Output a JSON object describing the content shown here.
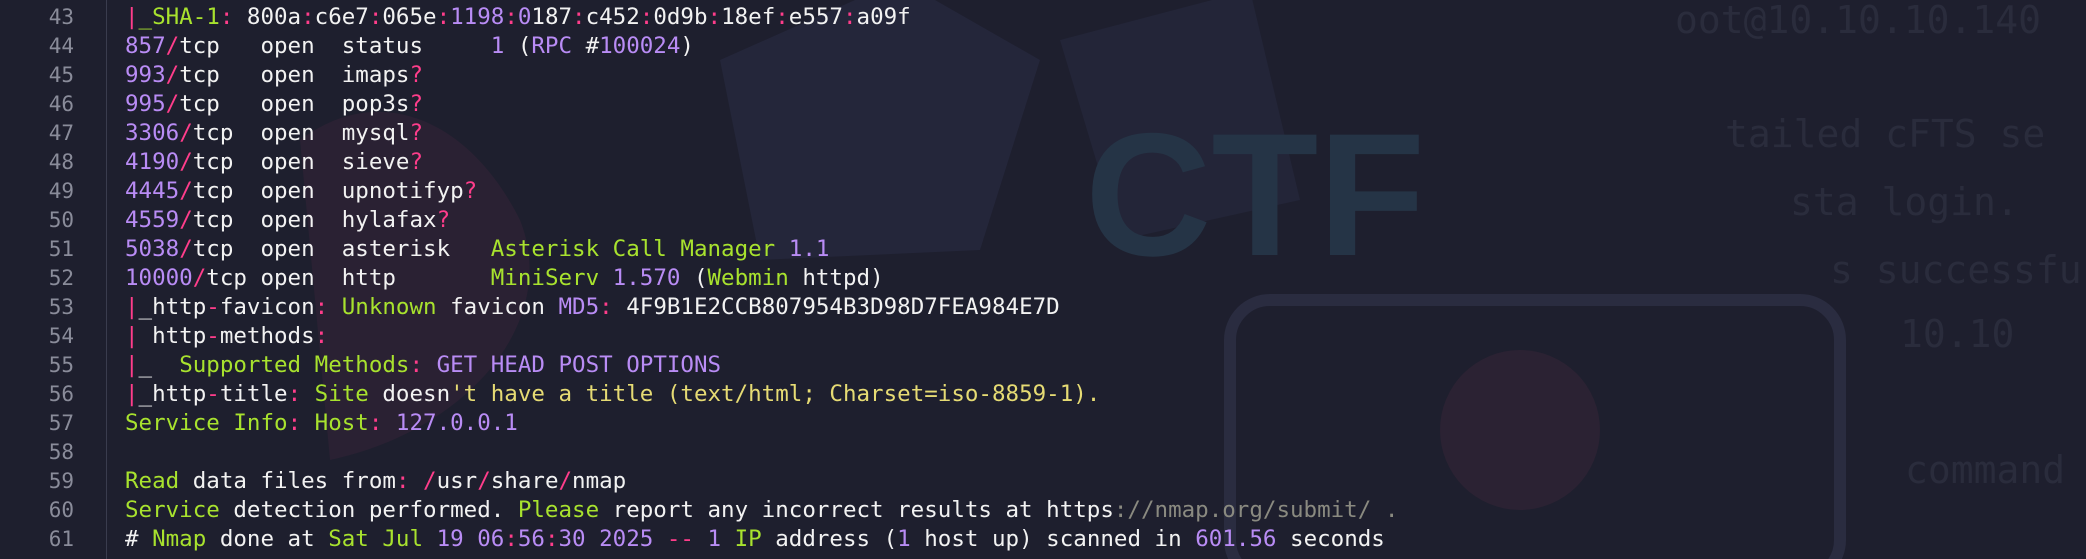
{
  "colors": {
    "background": "#1e1f2e",
    "default": "#f2f2f2",
    "number": "#b98cf5",
    "operator": "#ff3d8b",
    "keyword": "#a8e22e",
    "string": "#e6db74",
    "comment": "#8a8a80",
    "line_number": "#8a8c9a"
  },
  "background_watermark": {
    "logo_text": "CTF",
    "fragments": [
      "oot@10.10.10.140",
      "tailed cFTS se",
      "sta login.",
      "s successfu",
      "10.10",
      "command"
    ]
  },
  "editor": {
    "lines": [
      {
        "n": "43",
        "tokens": [
          [
            "|",
            "operator"
          ],
          [
            "_SHA-1",
            "keyword"
          ],
          [
            ":",
            "operator"
          ],
          [
            " 800a",
            "default"
          ],
          [
            ":",
            "operator"
          ],
          [
            "c6e7",
            "default"
          ],
          [
            ":",
            "operator"
          ],
          [
            "065e",
            "default"
          ],
          [
            ":",
            "operator"
          ],
          [
            "1198",
            "number"
          ],
          [
            ":",
            "operator"
          ],
          [
            "0",
            "number"
          ],
          [
            "187",
            "default"
          ],
          [
            ":",
            "operator"
          ],
          [
            "c452",
            "default"
          ],
          [
            ":",
            "operator"
          ],
          [
            "0d9b",
            "default"
          ],
          [
            ":",
            "operator"
          ],
          [
            "18ef",
            "default"
          ],
          [
            ":",
            "operator"
          ],
          [
            "e557",
            "default"
          ],
          [
            ":",
            "operator"
          ],
          [
            "a09f",
            "default"
          ]
        ]
      },
      {
        "n": "44",
        "tokens": [
          [
            "857",
            "number"
          ],
          [
            "/",
            "operator"
          ],
          [
            "tcp   open  status     ",
            "default"
          ],
          [
            "1",
            "number"
          ],
          [
            " (",
            "default"
          ],
          [
            "RPC",
            "number"
          ],
          [
            " #",
            "default"
          ],
          [
            "100024",
            "number"
          ],
          [
            ")",
            "default"
          ]
        ]
      },
      {
        "n": "45",
        "tokens": [
          [
            "993",
            "number"
          ],
          [
            "/",
            "operator"
          ],
          [
            "tcp   open  imaps",
            "default"
          ],
          [
            "?",
            "operator"
          ]
        ]
      },
      {
        "n": "46",
        "tokens": [
          [
            "995",
            "number"
          ],
          [
            "/",
            "operator"
          ],
          [
            "tcp   open  pop3s",
            "default"
          ],
          [
            "?",
            "operator"
          ]
        ]
      },
      {
        "n": "47",
        "tokens": [
          [
            "3306",
            "number"
          ],
          [
            "/",
            "operator"
          ],
          [
            "tcp  open  mysql",
            "default"
          ],
          [
            "?",
            "operator"
          ]
        ]
      },
      {
        "n": "48",
        "tokens": [
          [
            "4190",
            "number"
          ],
          [
            "/",
            "operator"
          ],
          [
            "tcp  open  sieve",
            "default"
          ],
          [
            "?",
            "operator"
          ]
        ]
      },
      {
        "n": "49",
        "tokens": [
          [
            "4445",
            "number"
          ],
          [
            "/",
            "operator"
          ],
          [
            "tcp  open  upnotifyp",
            "default"
          ],
          [
            "?",
            "operator"
          ]
        ]
      },
      {
        "n": "50",
        "tokens": [
          [
            "4559",
            "number"
          ],
          [
            "/",
            "operator"
          ],
          [
            "tcp  open  hylafax",
            "default"
          ],
          [
            "?",
            "operator"
          ]
        ]
      },
      {
        "n": "51",
        "tokens": [
          [
            "5038",
            "number"
          ],
          [
            "/",
            "operator"
          ],
          [
            "tcp  open  asterisk   ",
            "default"
          ],
          [
            "Asterisk Call Manager",
            "keyword"
          ],
          [
            " 1.1",
            "number"
          ]
        ]
      },
      {
        "n": "52",
        "tokens": [
          [
            "10000",
            "number"
          ],
          [
            "/",
            "operator"
          ],
          [
            "tcp open  http       ",
            "default"
          ],
          [
            "MiniServ",
            "keyword"
          ],
          [
            " 1.570",
            "number"
          ],
          [
            " (",
            "default"
          ],
          [
            "Webmin",
            "keyword"
          ],
          [
            " httpd)",
            "default"
          ]
        ]
      },
      {
        "n": "53",
        "tokens": [
          [
            "|",
            "operator"
          ],
          [
            "_http",
            "default"
          ],
          [
            "-",
            "operator"
          ],
          [
            "favicon",
            "default"
          ],
          [
            ":",
            "operator"
          ],
          [
            " Unknown",
            "keyword"
          ],
          [
            " favicon ",
            "default"
          ],
          [
            "MD5",
            "number"
          ],
          [
            ":",
            "operator"
          ],
          [
            " 4F9B1E2CCB807954B3D98D7FEA984E7D",
            "default"
          ]
        ]
      },
      {
        "n": "54",
        "tokens": [
          [
            "|",
            "operator"
          ],
          [
            " http",
            "default"
          ],
          [
            "-",
            "operator"
          ],
          [
            "methods",
            "default"
          ],
          [
            ":",
            "operator"
          ]
        ]
      },
      {
        "n": "55",
        "tokens": [
          [
            "|",
            "operator"
          ],
          [
            "_  ",
            "default"
          ],
          [
            "Supported Methods",
            "keyword"
          ],
          [
            ":",
            "operator"
          ],
          [
            " GET HEAD POST OPTIONS",
            "number"
          ]
        ]
      },
      {
        "n": "56",
        "tokens": [
          [
            "|",
            "operator"
          ],
          [
            "_http",
            "default"
          ],
          [
            "-",
            "operator"
          ],
          [
            "title",
            "default"
          ],
          [
            ":",
            "operator"
          ],
          [
            " Site",
            "keyword"
          ],
          [
            " doesn",
            "default"
          ],
          [
            "'t have a title (text/html; Charset=iso-8859-1).",
            "string"
          ]
        ]
      },
      {
        "n": "57",
        "tokens": [
          [
            "Service Info",
            "keyword"
          ],
          [
            ":",
            "operator"
          ],
          [
            " Host",
            "keyword"
          ],
          [
            ":",
            "operator"
          ],
          [
            " 127.0.0.1",
            "number"
          ]
        ]
      },
      {
        "n": "58",
        "tokens": []
      },
      {
        "n": "59",
        "tokens": [
          [
            "Read",
            "keyword"
          ],
          [
            " data files from",
            "default"
          ],
          [
            ":",
            "operator"
          ],
          [
            " ",
            "default"
          ],
          [
            "/",
            "operator"
          ],
          [
            "usr",
            "default"
          ],
          [
            "/",
            "operator"
          ],
          [
            "share",
            "default"
          ],
          [
            "/",
            "operator"
          ],
          [
            "nmap",
            "default"
          ]
        ]
      },
      {
        "n": "60",
        "tokens": [
          [
            "Service",
            "keyword"
          ],
          [
            " detection performed. ",
            "default"
          ],
          [
            "Please",
            "keyword"
          ],
          [
            " report any incorrect results at https",
            "default"
          ],
          [
            "://nmap.org/submit/ .",
            "comment"
          ]
        ]
      },
      {
        "n": "61",
        "tokens": [
          [
            "# ",
            "default"
          ],
          [
            "Nmap",
            "keyword"
          ],
          [
            " done at ",
            "default"
          ],
          [
            "Sat Jul",
            "keyword"
          ],
          [
            " 19 06",
            "number"
          ],
          [
            ":",
            "operator"
          ],
          [
            "56",
            "number"
          ],
          [
            ":",
            "operator"
          ],
          [
            "30 2025",
            "number"
          ],
          [
            " -- ",
            "operator"
          ],
          [
            "1",
            "number"
          ],
          [
            " IP",
            "keyword"
          ],
          [
            " address (",
            "default"
          ],
          [
            "1",
            "number"
          ],
          [
            " host up) scanned in ",
            "default"
          ],
          [
            "601.56",
            "number"
          ],
          [
            " seconds",
            "default"
          ]
        ]
      }
    ]
  }
}
